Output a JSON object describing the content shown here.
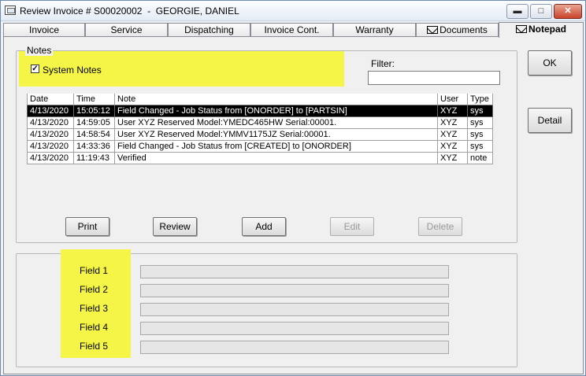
{
  "window": {
    "title": "Review Invoice # S00020002  -  GEORGIE, DANIEL",
    "min_glyph": "▬",
    "max_glyph": "□",
    "close_glyph": "✕"
  },
  "tabs": [
    {
      "label": "Invoice"
    },
    {
      "label": "Service"
    },
    {
      "label": "Dispatching"
    },
    {
      "label": "Invoice Cont."
    },
    {
      "label": "Warranty"
    },
    {
      "label": "Documents",
      "icon": "envelope-icon"
    },
    {
      "label": "Notepad",
      "icon": "envelope-icon",
      "active": true
    }
  ],
  "notes": {
    "group_title": "Notes",
    "system_notes_label": "System Notes",
    "system_notes_checked": true,
    "check_glyph": "✓",
    "filter_label": "Filter:",
    "filter_value": "",
    "columns": {
      "date": "Date",
      "time": "Time",
      "note": "Note",
      "user": "User",
      "type": "Type"
    },
    "rows": [
      {
        "date": "4/13/2020",
        "time": "15:05:12",
        "note": "Field Changed - Job Status from [ONORDER] to [PARTSIN]",
        "user": "XYZ",
        "type": "sys",
        "selected": true
      },
      {
        "date": "4/13/2020",
        "time": "14:59:05",
        "note": "User XYZ Reserved Model:YMEDC465HW Serial:00001.",
        "user": "XYZ",
        "type": "sys"
      },
      {
        "date": "4/13/2020",
        "time": "14:58:54",
        "note": "User XYZ Reserved Model:YMMV1175JZ Serial:00001.",
        "user": "XYZ",
        "type": "sys"
      },
      {
        "date": "4/13/2020",
        "time": "14:33:36",
        "note": "Field Changed - Job Status from [CREATED] to [ONORDER]",
        "user": "XYZ",
        "type": "sys"
      },
      {
        "date": "4/13/2020",
        "time": "11:19:43",
        "note": "Verified",
        "user": "XYZ",
        "type": "note"
      }
    ],
    "buttons": {
      "print": "Print",
      "review": "Review",
      "add": "Add",
      "edit": "Edit",
      "delete": "Delete"
    }
  },
  "side_buttons": {
    "ok": "OK",
    "detail": "Detail"
  },
  "fields": [
    {
      "label": "Field 1",
      "value": ""
    },
    {
      "label": "Field 2",
      "value": ""
    },
    {
      "label": "Field 3",
      "value": ""
    },
    {
      "label": "Field 4",
      "value": ""
    },
    {
      "label": "Field 5",
      "value": ""
    }
  ],
  "colors": {
    "highlight": "#f5f547",
    "selected_row_bg": "#000000",
    "selected_row_fg": "#ffffff"
  }
}
